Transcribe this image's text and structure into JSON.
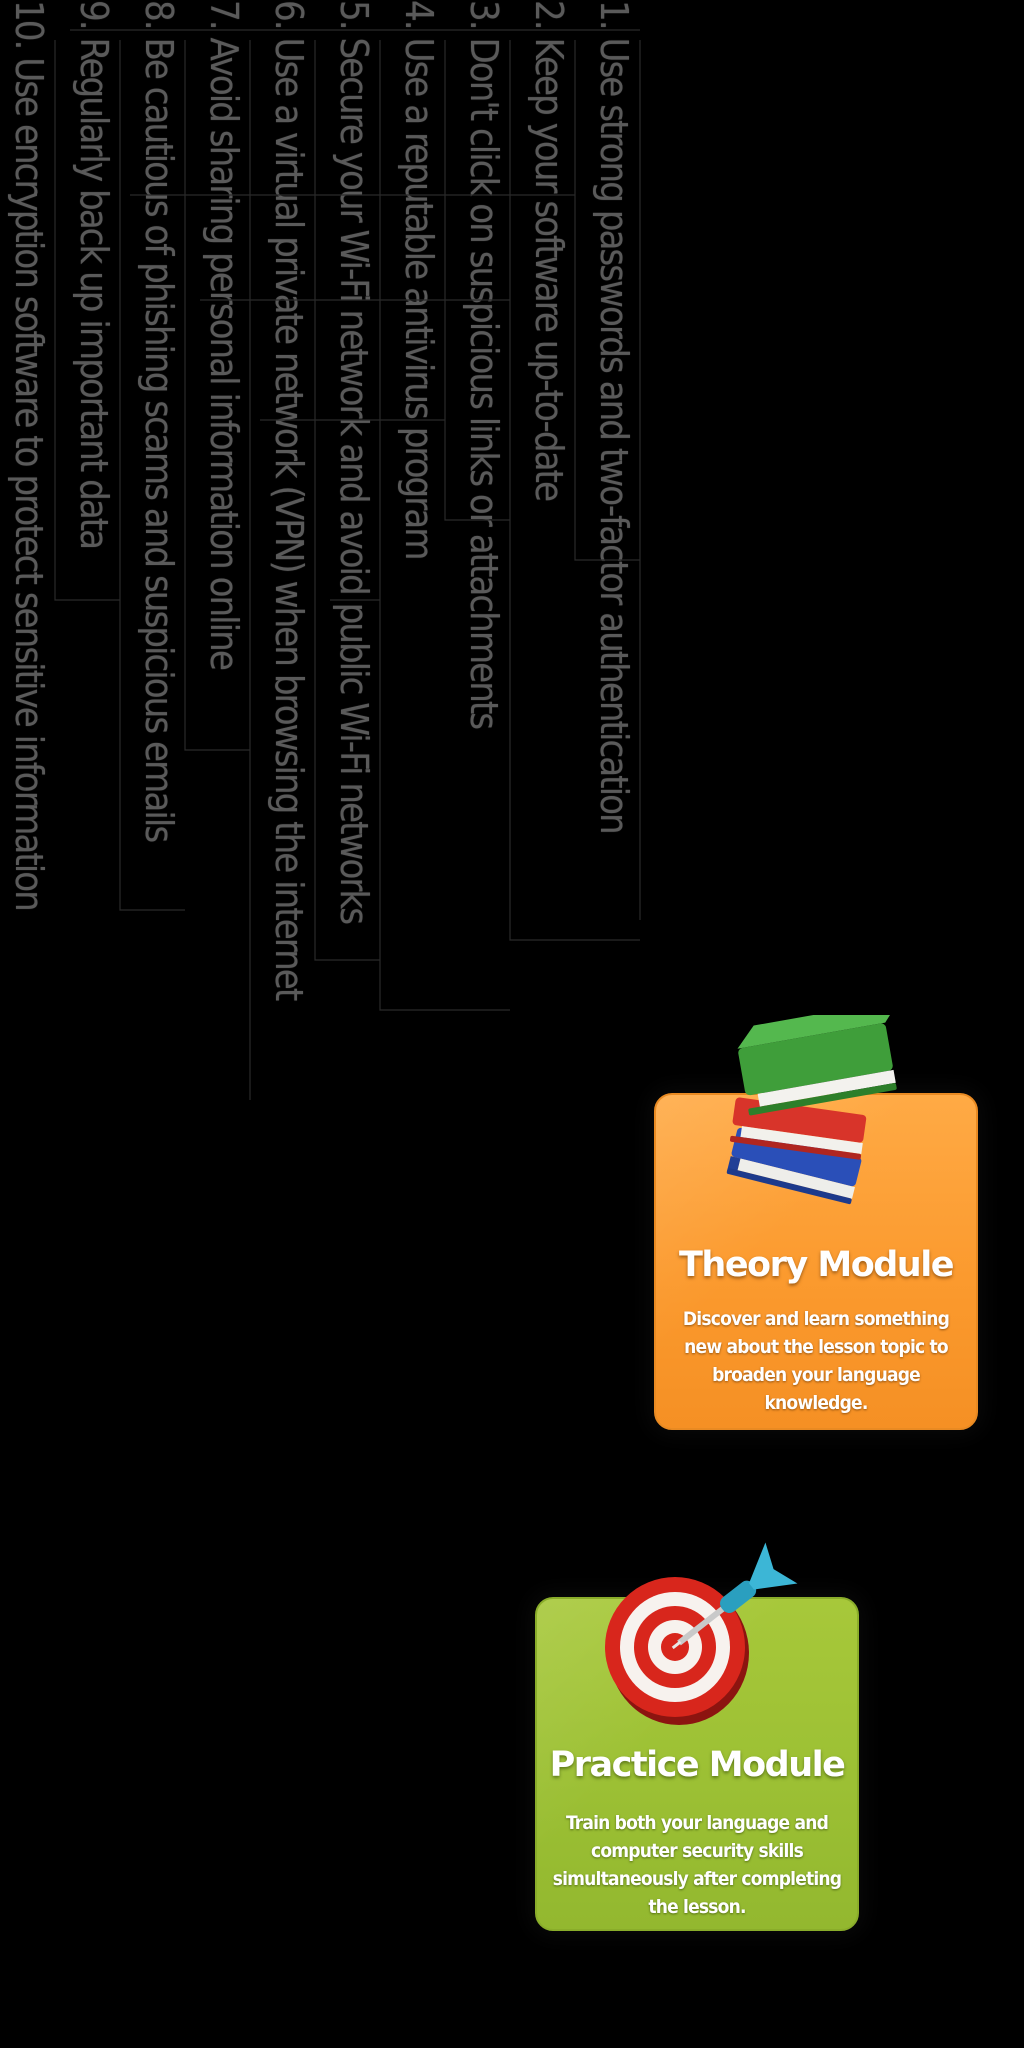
{
  "tips": [
    "1. Use strong passwords and two-factor authentication",
    "2. Keep your software up-to-date",
    "3. Don't click on suspicious links or attachments",
    "4. Use a reputable antivirus program",
    "5. Secure your Wi-Fi network and avoid public Wi-Fi networks",
    "6. Use a virtual private network (VPN) when browsing the internet",
    "7. Avoid sharing personal information online",
    "8. Be cautious of phishing scams and suspicious emails",
    "9. Regularly back up important data",
    "10. Use encryption software to protect sensitive information"
  ],
  "theory_card": {
    "icon": "books-icon",
    "title": "Theory Module",
    "description": "Discover and learn something new about the lesson topic to broaden your language knowledge.",
    "color": "#fb9a2e"
  },
  "practice_card": {
    "icon": "target-dart-icon",
    "title": "Practice Module",
    "description": "Train both your language and computer security skills simultaneously after completing the lesson.",
    "color": "#9cc034"
  }
}
